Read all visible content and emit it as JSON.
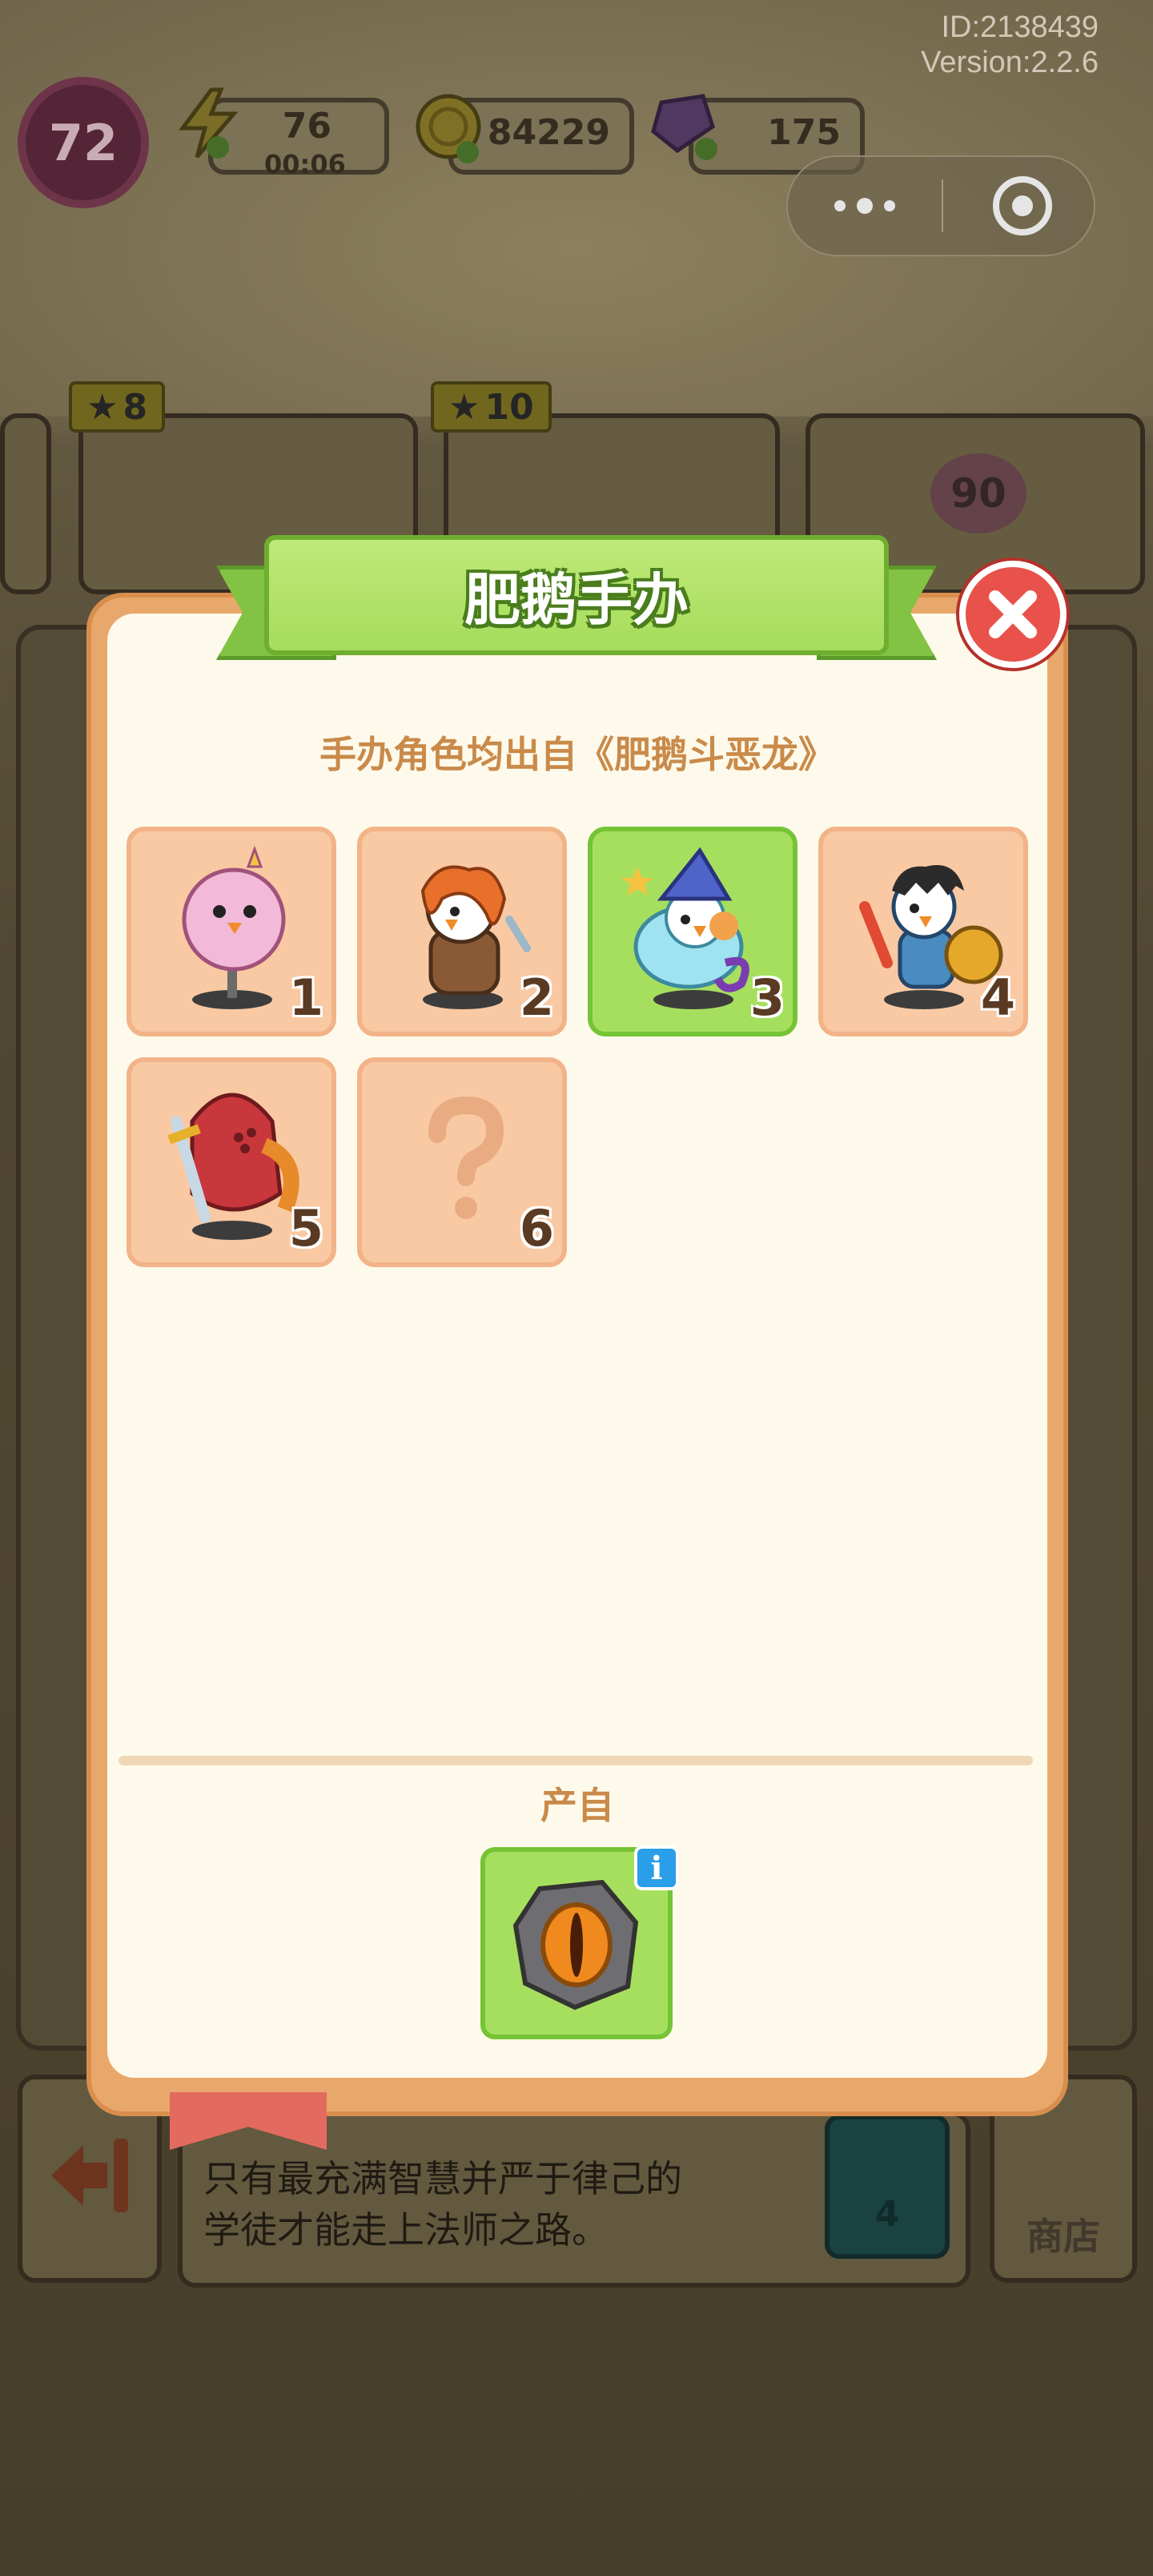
{
  "system": {
    "id_text": "ID:2138439",
    "version_text": "Version:2.2.6"
  },
  "hud": {
    "level": "72",
    "energy": {
      "value": "76",
      "timer": "00:06"
    },
    "coins": "84229",
    "gems": "175"
  },
  "background": {
    "cards": [
      {
        "stars": "8"
      },
      {
        "stars": "10"
      }
    ],
    "unlock_text": "90",
    "description": "只有最充满智慧并严于律己的\n学徒才能走上法师之路。",
    "coin_cost": "4",
    "shop_label": "商店"
  },
  "modal": {
    "title": "肥鹅手办",
    "subtitle": "手办角色均出自《肥鹅斗恶龙》",
    "figures": [
      {
        "number": "1",
        "icon": "pink-goose-figure-icon",
        "selected": false,
        "unlocked": true
      },
      {
        "number": "2",
        "icon": "warrior-goose-figure-icon",
        "selected": false,
        "unlocked": true
      },
      {
        "number": "3",
        "icon": "wizard-goose-figure-icon",
        "selected": true,
        "unlocked": true
      },
      {
        "number": "4",
        "icon": "knight-goose-figure-icon",
        "selected": false,
        "unlocked": true
      },
      {
        "number": "5",
        "icon": "red-armor-goose-figure-icon",
        "selected": false,
        "unlocked": true
      },
      {
        "number": "6",
        "icon": "question-mark-icon",
        "selected": false,
        "unlocked": false
      }
    ],
    "source_label": "产自",
    "source_icon": "dragon-eye-stone-icon",
    "info_badge": "i"
  },
  "colors": {
    "accent_green": "#a6df5e",
    "card_peach": "#f9c9a3",
    "close_red": "#e8524a",
    "text_brown": "#c98a4a"
  }
}
